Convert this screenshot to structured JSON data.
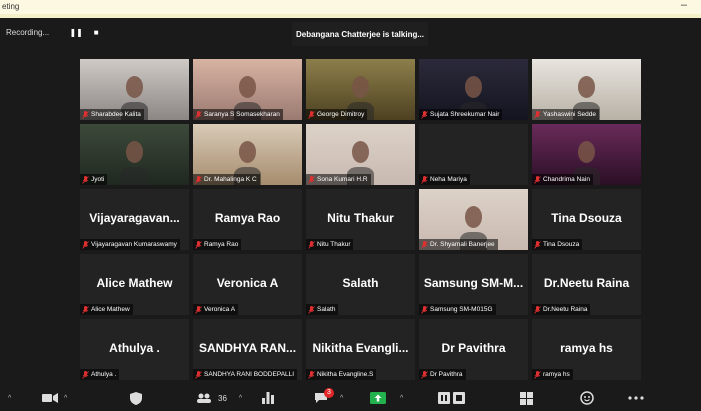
{
  "window": {
    "title": "eting",
    "minimize": "–"
  },
  "recording": {
    "label": "Recording...",
    "pause": "❚❚",
    "stop": "■"
  },
  "talking": "Debangana Chatterjee is talking...",
  "tiles": [
    {
      "name": "Sharabdee Kalita",
      "video": "v-gray"
    },
    {
      "name": "Saranya S Somasekharan",
      "video": "v-pink"
    },
    {
      "name": "George Dimitroy",
      "video": "v-olive"
    },
    {
      "name": "Sujata Shreekumar Nair",
      "video": "v-dark"
    },
    {
      "name": "Yashaswini Sedde",
      "video": "v-light"
    },
    {
      "name": "Jyoti",
      "video": "v-green"
    },
    {
      "name": "Dr. Mahalinga K C",
      "video": "v-beige"
    },
    {
      "name": "Sona Kumari H.R",
      "video": "v-sky"
    },
    {
      "name": "Neha Mariya",
      "big": ""
    },
    {
      "name": "Chandrima Nain",
      "video": "v-purple"
    },
    {
      "name": "Vijayaragavan Kumaraswamy",
      "big": "Vijayaragavan..."
    },
    {
      "name": "Ramya Rao",
      "big": "Ramya Rao"
    },
    {
      "name": "Nitu Thakur",
      "big": "Nitu Thakur"
    },
    {
      "name": "Dr. Shyamali Banerjee",
      "video": "v-sky"
    },
    {
      "name": "Tina Dsouza",
      "big": "Tina Dsouza"
    },
    {
      "name": "Alice Mathew",
      "big": "Alice Mathew"
    },
    {
      "name": "Veronica A",
      "big": "Veronica A"
    },
    {
      "name": "Salath",
      "big": "Salath"
    },
    {
      "name": "Samsung SM-M015G",
      "big": "Samsung SM-M..."
    },
    {
      "name": "Dr.Neetu Raina",
      "big": "Dr.Neetu Raina"
    },
    {
      "name": "Athulya .",
      "big": "Athulya ."
    },
    {
      "name": "SANDHYA RANI BODDEPALLI",
      "big": "SANDHYA RAN..."
    },
    {
      "name": "Nikitha Evangline.S",
      "big": "Nikitha Evangli..."
    },
    {
      "name": "Dr Pavithra",
      "big": "Dr Pavithra"
    },
    {
      "name": "ramya hs",
      "big": "ramya hs"
    }
  ],
  "toolbar": {
    "participants_count": "36",
    "chat_badge": "3",
    "caret": "^"
  },
  "colors": {
    "muted_mic": "#e03030",
    "share_green": "#22b14c",
    "badge_red": "#e02828"
  }
}
